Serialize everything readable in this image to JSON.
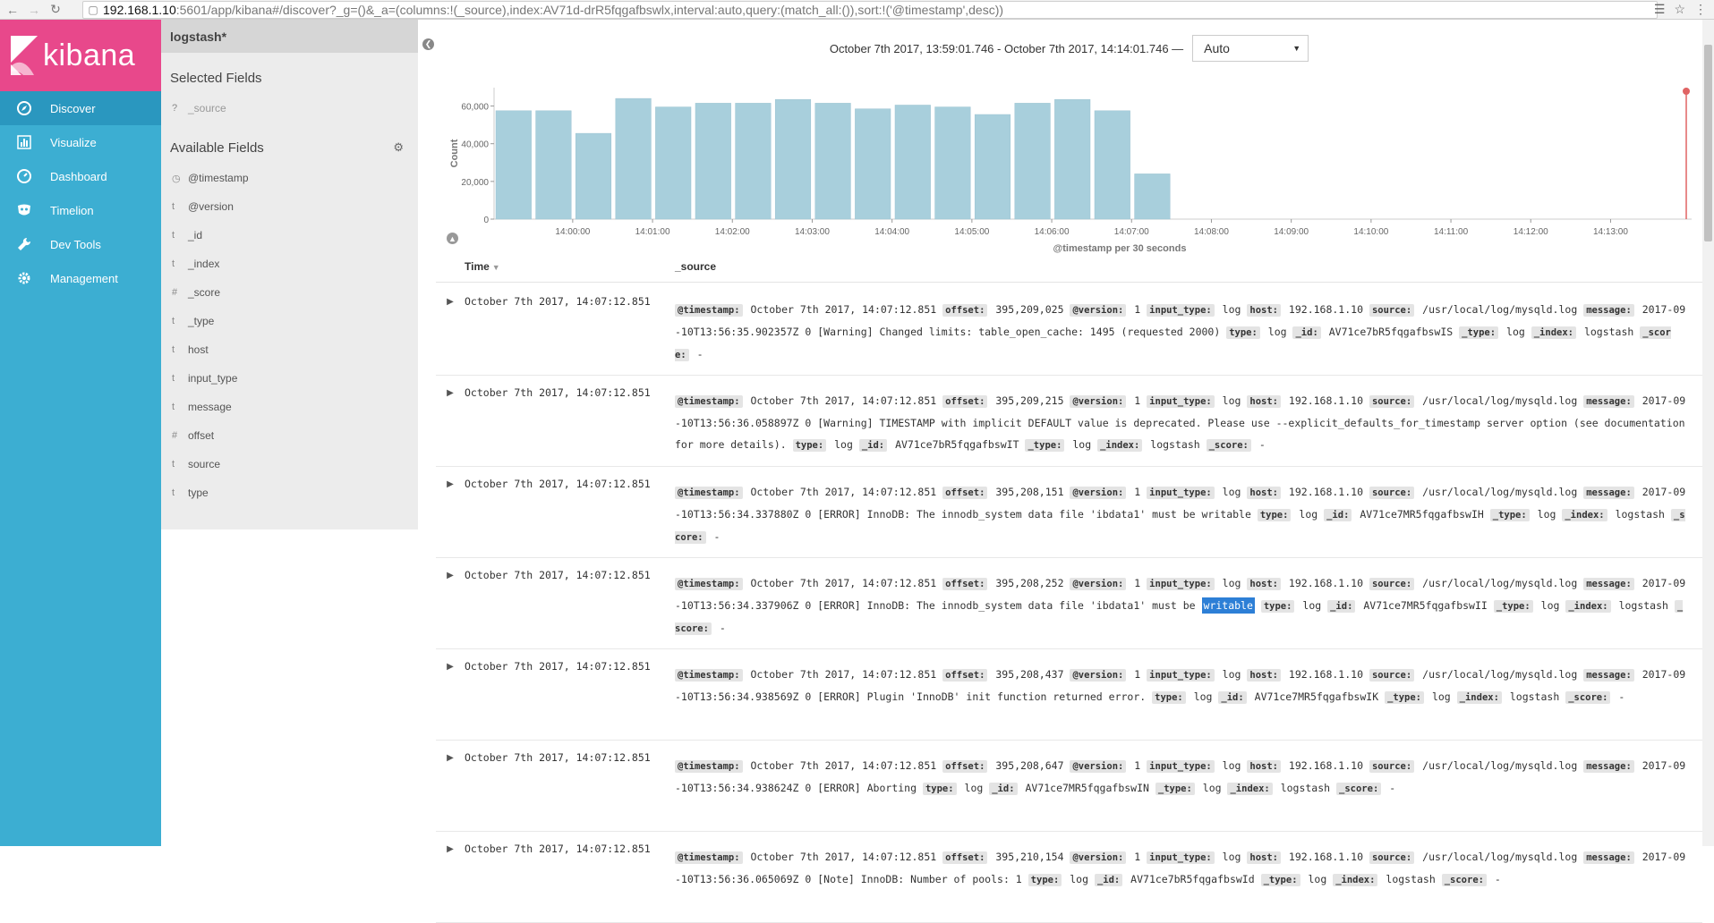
{
  "browser": {
    "url_host": "192.168.1.10",
    "url_path": ":5601/app/kibana#/discover?_g=()&_a=(columns:!(_source),index:AV71d-drR5fqgafbswlx,interval:auto,query:(match_all:()),sort:!('@timestamp',desc))"
  },
  "nav": {
    "brand": "kibana",
    "items": [
      {
        "label": "Discover",
        "icon": "compass-icon",
        "active": true
      },
      {
        "label": "Visualize",
        "icon": "bar-chart-icon",
        "active": false
      },
      {
        "label": "Dashboard",
        "icon": "dashboard-icon",
        "active": false
      },
      {
        "label": "Timelion",
        "icon": "timelion-mask-icon",
        "active": false
      },
      {
        "label": "Dev Tools",
        "icon": "wrench-icon",
        "active": false
      },
      {
        "label": "Management",
        "icon": "gear-icon",
        "active": false
      }
    ]
  },
  "sidebar": {
    "index_pattern": "logstash*",
    "selected_title": "Selected Fields",
    "selected_fields": [
      {
        "type": "?",
        "name": "_source"
      }
    ],
    "available_title": "Available Fields",
    "available_fields": [
      {
        "type": "clock",
        "name": "@timestamp"
      },
      {
        "type": "t",
        "name": "@version"
      },
      {
        "type": "t",
        "name": "_id"
      },
      {
        "type": "t",
        "name": "_index"
      },
      {
        "type": "#",
        "name": "_score"
      },
      {
        "type": "t",
        "name": "_type"
      },
      {
        "type": "t",
        "name": "host"
      },
      {
        "type": "t",
        "name": "input_type"
      },
      {
        "type": "t",
        "name": "message"
      },
      {
        "type": "#",
        "name": "offset"
      },
      {
        "type": "t",
        "name": "source"
      },
      {
        "type": "t",
        "name": "type"
      }
    ]
  },
  "timebar": {
    "range": "October 7th 2017, 13:59:01.746 - October 7th 2017, 14:14:01.746 —",
    "interval": "Auto"
  },
  "chart_data": {
    "type": "bar",
    "ylabel": "Count",
    "xlabel": "@timestamp per 30 seconds",
    "ylim": [
      0,
      65000
    ],
    "yticks": [
      "0",
      "20,000",
      "40,000",
      "60,000"
    ],
    "xticks": [
      "14:00:00",
      "14:01:00",
      "14:02:00",
      "14:03:00",
      "14:04:00",
      "14:05:00",
      "14:06:00",
      "14:07:00",
      "14:08:00",
      "14:09:00",
      "14:10:00",
      "14:11:00",
      "14:12:00",
      "14:13:00"
    ],
    "values": [
      57500,
      57500,
      45500,
      64000,
      59500,
      61500,
      61500,
      63500,
      61500,
      58500,
      60500,
      59500,
      55500,
      61500,
      63500,
      57500,
      24000
    ],
    "bar_color": "#a8cfdc"
  },
  "table": {
    "time_header": "Time",
    "source_header": "_source",
    "rows": [
      {
        "time": "October 7th 2017, 14:07:12.851",
        "fields": [
          {
            "k": "@timestamp:",
            "v": "October 7th 2017, 14:07:12.851"
          },
          {
            "k": "offset:",
            "v": "395,209,025"
          },
          {
            "k": "@version:",
            "v": "1"
          },
          {
            "k": "input_type:",
            "v": "log"
          },
          {
            "k": "host:",
            "v": "192.168.1.10"
          },
          {
            "k": "source:",
            "v": "/usr/local/log/mysqld.log"
          },
          {
            "k": "message:",
            "v": "2017-09-10T13:56:35.902357Z 0 [Warning] Changed limits: table_open_cache: 1495 (requested 2000)"
          },
          {
            "k": "type:",
            "v": "log"
          },
          {
            "k": "_id:",
            "v": "AV71ce7bR5fqgafbswIS"
          },
          {
            "k": "_type:",
            "v": "log"
          },
          {
            "k": "_index:",
            "v": "logstash"
          },
          {
            "k": "_score:",
            "v": "-"
          }
        ]
      },
      {
        "time": "October 7th 2017, 14:07:12.851",
        "fields": [
          {
            "k": "@timestamp:",
            "v": "October 7th 2017, 14:07:12.851"
          },
          {
            "k": "offset:",
            "v": "395,209,215"
          },
          {
            "k": "@version:",
            "v": "1"
          },
          {
            "k": "input_type:",
            "v": "log"
          },
          {
            "k": "host:",
            "v": "192.168.1.10"
          },
          {
            "k": "source:",
            "v": "/usr/local/log/mysqld.log"
          },
          {
            "k": "message:",
            "v": "2017-09-10T13:56:36.058897Z 0 [Warning] TIMESTAMP with implicit DEFAULT value is deprecated. Please use --explicit_defaults_for_timestamp server option (see documentation for more details)."
          },
          {
            "k": "type:",
            "v": "log"
          },
          {
            "k": "_id:",
            "v": "AV71ce7bR5fqgafbswIT"
          },
          {
            "k": "_type:",
            "v": "log"
          },
          {
            "k": "_index:",
            "v": "logstash"
          },
          {
            "k": "_score:",
            "v": "-"
          }
        ]
      },
      {
        "time": "October 7th 2017, 14:07:12.851",
        "fields": [
          {
            "k": "@timestamp:",
            "v": "October 7th 2017, 14:07:12.851"
          },
          {
            "k": "offset:",
            "v": "395,208,151"
          },
          {
            "k": "@version:",
            "v": "1"
          },
          {
            "k": "input_type:",
            "v": "log"
          },
          {
            "k": "host:",
            "v": "192.168.1.10"
          },
          {
            "k": "source:",
            "v": "/usr/local/log/mysqld.log"
          },
          {
            "k": "message:",
            "v": "2017-09-10T13:56:34.337880Z 0 [ERROR] InnoDB: The innodb_system data file 'ibdata1' must be writable"
          },
          {
            "k": "type:",
            "v": "log"
          },
          {
            "k": "_id:",
            "v": "AV71ce7MR5fqgafbswIH"
          },
          {
            "k": "_type:",
            "v": "log"
          },
          {
            "k": "_index:",
            "v": "logstash"
          },
          {
            "k": "_score:",
            "v": "-"
          }
        ]
      },
      {
        "time": "October 7th 2017, 14:07:12.851",
        "fields": [
          {
            "k": "@timestamp:",
            "v": "October 7th 2017, 14:07:12.851"
          },
          {
            "k": "offset:",
            "v": "395,208,252"
          },
          {
            "k": "@version:",
            "v": "1"
          },
          {
            "k": "input_type:",
            "v": "log"
          },
          {
            "k": "host:",
            "v": "192.168.1.10"
          },
          {
            "k": "source:",
            "v": "/usr/local/log/mysqld.log"
          },
          {
            "k": "message:",
            "v": "2017-09-10T13:56:34.337906Z 0 [ERROR] InnoDB: The innodb_system data file 'ibdata1' must be ",
            "hl": "writable"
          },
          {
            "k": "type:",
            "v": "log"
          },
          {
            "k": "_id:",
            "v": "AV71ce7MR5fqgafbswII"
          },
          {
            "k": "_type:",
            "v": "log"
          },
          {
            "k": "_index:",
            "v": "logstash"
          },
          {
            "k": "_score:",
            "v": "-"
          }
        ]
      },
      {
        "time": "October 7th 2017, 14:07:12.851",
        "fields": [
          {
            "k": "@timestamp:",
            "v": "October 7th 2017, 14:07:12.851"
          },
          {
            "k": "offset:",
            "v": "395,208,437"
          },
          {
            "k": "@version:",
            "v": "1"
          },
          {
            "k": "input_type:",
            "v": "log"
          },
          {
            "k": "host:",
            "v": "192.168.1.10"
          },
          {
            "k": "source:",
            "v": "/usr/local/log/mysqld.log"
          },
          {
            "k": "message:",
            "v": "2017-09-10T13:56:34.938569Z 0 [ERROR] Plugin 'InnoDB' init function returned error."
          },
          {
            "k": "type:",
            "v": "log"
          },
          {
            "k": "_id:",
            "v": "AV71ce7MR5fqgafbswIK"
          },
          {
            "k": "_type:",
            "v": "log"
          },
          {
            "k": "_index:",
            "v": "logstash"
          },
          {
            "k": "_score:",
            "v": "-"
          }
        ]
      },
      {
        "time": "October 7th 2017, 14:07:12.851",
        "fields": [
          {
            "k": "@timestamp:",
            "v": "October 7th 2017, 14:07:12.851"
          },
          {
            "k": "offset:",
            "v": "395,208,647"
          },
          {
            "k": "@version:",
            "v": "1"
          },
          {
            "k": "input_type:",
            "v": "log"
          },
          {
            "k": "host:",
            "v": "192.168.1.10"
          },
          {
            "k": "source:",
            "v": "/usr/local/log/mysqld.log"
          },
          {
            "k": "message:",
            "v": "2017-09-10T13:56:34.938624Z 0 [ERROR] Aborting"
          },
          {
            "k": "type:",
            "v": "log"
          },
          {
            "k": "_id:",
            "v": "AV71ce7MR5fqgafbswIN"
          },
          {
            "k": "_type:",
            "v": "log"
          },
          {
            "k": "_index:",
            "v": "logstash"
          },
          {
            "k": "_score:",
            "v": "-"
          }
        ]
      },
      {
        "time": "October 7th 2017, 14:07:12.851",
        "fields": [
          {
            "k": "@timestamp:",
            "v": "October 7th 2017, 14:07:12.851"
          },
          {
            "k": "offset:",
            "v": "395,210,154"
          },
          {
            "k": "@version:",
            "v": "1"
          },
          {
            "k": "input_type:",
            "v": "log"
          },
          {
            "k": "host:",
            "v": "192.168.1.10"
          },
          {
            "k": "source:",
            "v": "/usr/local/log/mysqld.log"
          },
          {
            "k": "message:",
            "v": "2017-09-10T13:56:36.065069Z 0 [Note] InnoDB: Number of pools: 1"
          },
          {
            "k": "type:",
            "v": "log"
          },
          {
            "k": "_id:",
            "v": "AV71ce7bR5fqgafbswId"
          },
          {
            "k": "_type:",
            "v": "log"
          },
          {
            "k": "_index:",
            "v": "logstash"
          },
          {
            "k": "_score:",
            "v": "-"
          }
        ]
      }
    ]
  }
}
